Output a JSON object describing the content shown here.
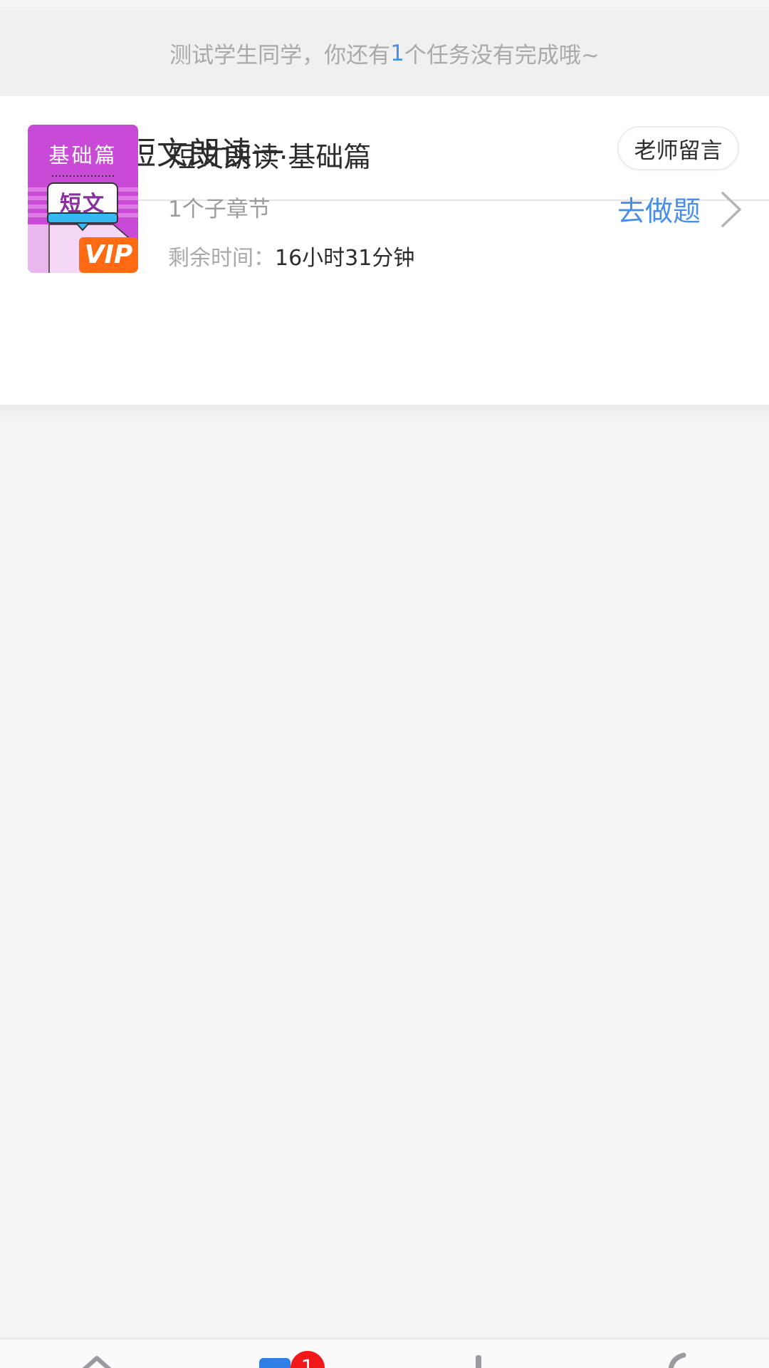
{
  "notice": {
    "prefix": "测试学生同学，你还有",
    "count": "1",
    "suffix": "个任务没有完成哦~"
  },
  "task": {
    "title": "基础篇短文朗读一",
    "teacher_message_label": "老师留言"
  },
  "course": {
    "cover": {
      "top_label": "基础篇",
      "center_label": "短文",
      "badge_label": "VIP"
    },
    "name": "短文朗读·基础篇",
    "subsections": "1个子章节",
    "remaining_label": "剩余时间：",
    "remaining_value": "16小时31分钟",
    "action_label": "去做题"
  },
  "tabbar": {
    "tabs": [
      {
        "icon": "home-icon"
      },
      {
        "icon": "task-icon",
        "badge": "1"
      },
      {
        "icon": "discover-icon"
      },
      {
        "icon": "profile-icon"
      }
    ]
  },
  "colors": {
    "accent": "#4a8fe7",
    "badge_red": "#f01818",
    "cover_purple": "#c94ad6",
    "vip_orange": "#ff6a13"
  }
}
